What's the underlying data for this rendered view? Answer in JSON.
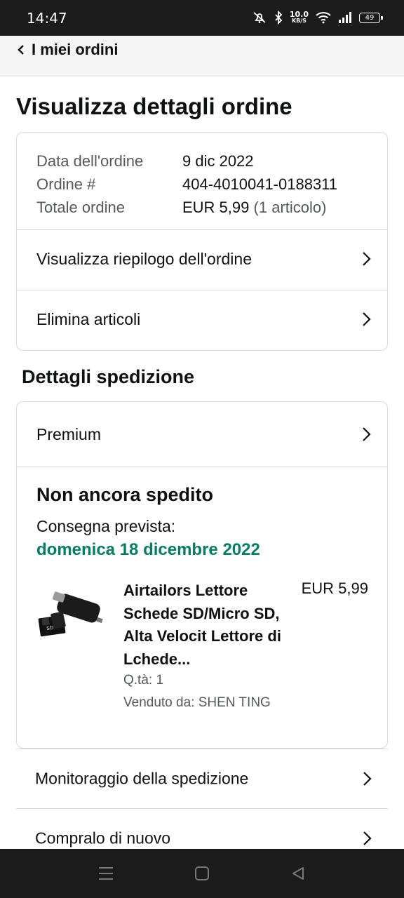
{
  "status_bar": {
    "time": "14:47",
    "net_speed_value": "10.0",
    "net_speed_unit": "KB/S",
    "battery": "49",
    "icons": [
      "mute-icon",
      "bluetooth-icon",
      "wifi-icon",
      "signal-icon",
      "battery-icon"
    ]
  },
  "header": {
    "back_label": "I miei ordini"
  },
  "page": {
    "title": "Visualizza dettagli ordine"
  },
  "order_info": {
    "date_label": "Data dell'ordine",
    "date_value": "9 dic 2022",
    "number_label": "Ordine #",
    "number_value": "404-4010041-0188311",
    "total_label": "Totale ordine",
    "total_value": "EUR 5,99",
    "total_count": "(1 articolo)"
  },
  "order_actions": {
    "summary_label": "Visualizza riepilogo dell'ordine",
    "delete_label": "Elimina articoli"
  },
  "shipping": {
    "section_title": "Dettagli spedizione",
    "method_label": "Premium",
    "status": "Non ancora spedito",
    "delivery_label": "Consegna prevista:",
    "delivery_date": "domenica 18 dicembre 2022",
    "delivery_color": "#067d62"
  },
  "product": {
    "title": "Airtailors Lettore Schede SD/Micro SD, Alta Velocit Lettore di Lchede...",
    "price": "EUR 5,99",
    "quantity": "Q.tà: 1",
    "seller": "Venduto da: SHEN TING"
  },
  "bottom_actions": {
    "track_label": "Monitoraggio della spedizione",
    "buy_again_label": "Compralo di nuovo"
  },
  "nav_bar": {
    "icons": [
      "menu-icon",
      "home-square-icon",
      "back-triangle-icon"
    ]
  }
}
